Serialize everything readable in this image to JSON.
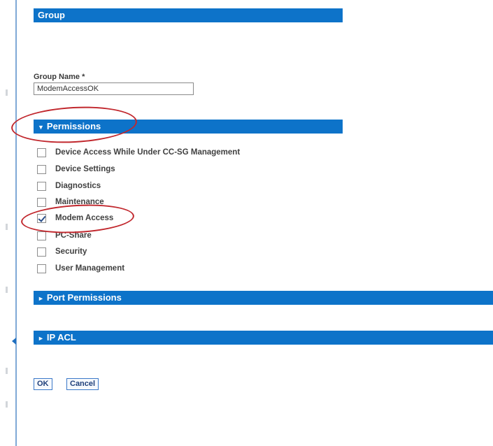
{
  "group_header": {
    "title": "Group"
  },
  "group_name": {
    "label": "Group Name *",
    "value": "ModemAccessOK"
  },
  "permissions": {
    "arrow": "▼",
    "title": "Permissions",
    "items": [
      {
        "label": "Device Access While Under CC-SG Management",
        "checked": false
      },
      {
        "label": "Device Settings",
        "checked": false
      },
      {
        "label": "Diagnostics",
        "checked": false
      },
      {
        "label": "Maintenance",
        "checked": false
      },
      {
        "label": "Modem Access",
        "checked": true
      },
      {
        "label": "PC-Share",
        "checked": false
      },
      {
        "label": "Security",
        "checked": false
      },
      {
        "label": "User Management",
        "checked": false
      }
    ]
  },
  "port_permissions": {
    "arrow": "►",
    "title": "Port Permissions"
  },
  "ip_acl": {
    "arrow": "►",
    "title": "IP ACL"
  },
  "buttons": {
    "ok": "OK",
    "cancel": "Cancel"
  },
  "colors": {
    "section_bar": "#0d73c9",
    "highlight_oval": "#c1272d",
    "left_rule": "#7fa9d6"
  },
  "icons": {
    "expanded": "triangle-down-icon",
    "collapsed": "triangle-right-icon",
    "checkbox": "checkbox-icon"
  }
}
